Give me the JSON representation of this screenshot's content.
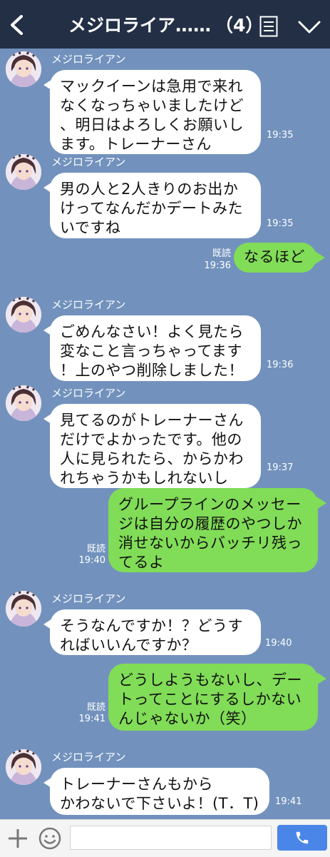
{
  "header": {
    "title": "メジロライア……",
    "member_count": "（4）",
    "icons": [
      "back-icon",
      "notes-icon",
      "chevron-down-icon"
    ]
  },
  "messages": [
    {
      "sender": "メジロライアン",
      "text": "マックイーンは急用で来れ\nなくなっちゃいましたけど\n、明日はよろしくお願いし\nます。トレーナーさん",
      "time": "19:35"
    },
    {
      "sender": "メジロライアン",
      "text": "男の人と2人きりのお出か\nけってなんだかデートみた\nいですね",
      "time": "19:35"
    },
    {
      "mine": true,
      "read": "既読",
      "time": "19:36",
      "text": "なるほど"
    },
    {
      "sender": "メジロライアン",
      "text": "ごめんなさい！よく見たら\n変なこと言っちゃってます\n！上のやつ削除しました！",
      "time": "19:36"
    },
    {
      "sender": "メジロライアン",
      "text": "見てるのがトレーナーさん\nだけでよかったです。他の\n人に見られたら、からかわ\nれちゃうかもしれないし",
      "time": "19:37"
    },
    {
      "mine": true,
      "read": "既読",
      "time": "19:40",
      "text": "グループラインのメッセー\nジは自分の履歴のやつしか\n消せないからバッチリ残っ\nてるよ"
    },
    {
      "sender": "メジロライアン",
      "text": "そうなんですか！？どうす\nればいいんですか？",
      "time": "19:40"
    },
    {
      "mine": true,
      "read": "既読",
      "time": "19:41",
      "text": "どうしようもないし、デー\nトってことにするしかない\nんじゃないか（笑）"
    },
    {
      "sender": "メジロライアン",
      "text": "トレーナーさんもから\nかわないで下さいよ！(T．T)",
      "time": "19:41"
    }
  ],
  "footer": {
    "input_value": "",
    "icons": [
      "plus-icon",
      "emoji-icon",
      "phone-icon"
    ]
  }
}
